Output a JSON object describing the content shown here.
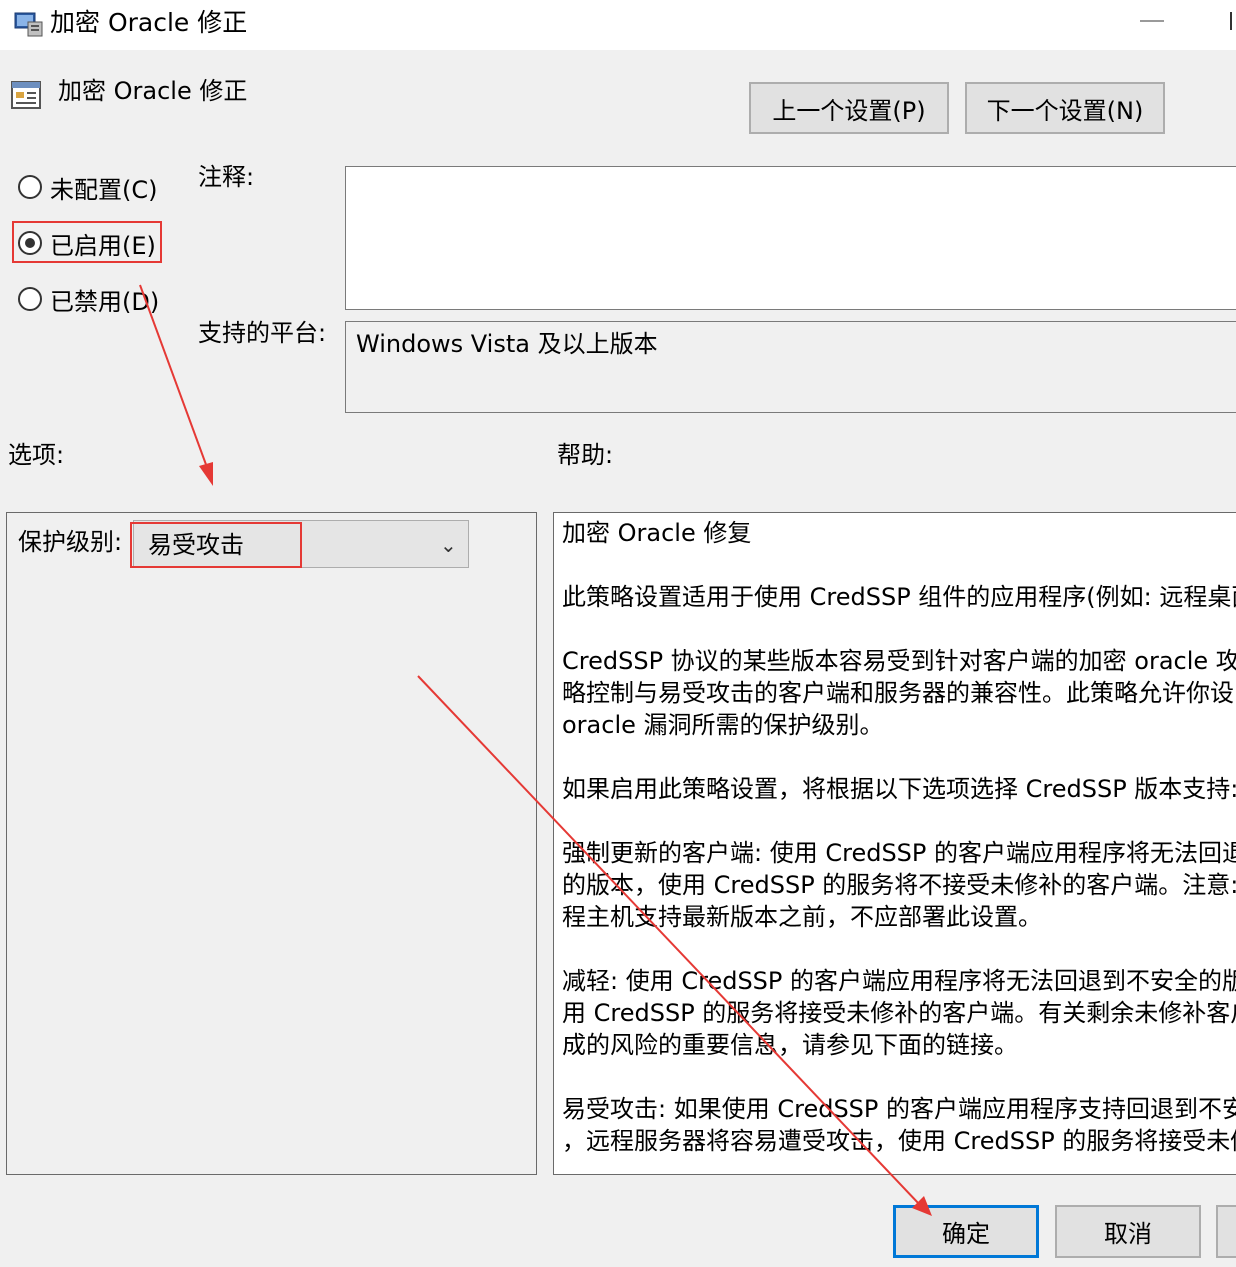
{
  "window": {
    "title": "加密 Oracle 修正"
  },
  "header": {
    "title": "加密 Oracle 修正"
  },
  "nav": {
    "prev_label": "上一个设置(P)",
    "next_label": "下一个设置(N)"
  },
  "state": {
    "not_configured_label": "未配置(C)",
    "enabled_label": "已启用(E)",
    "disabled_label": "已禁用(D)",
    "selected": "enabled"
  },
  "comment": {
    "label": "注释:",
    "value": ""
  },
  "platform": {
    "label": "支持的平台:",
    "value": "Windows Vista 及以上版本"
  },
  "options": {
    "label": "选项:",
    "protection_level_label": "保护级别:",
    "protection_level_value": "易受攻击"
  },
  "help": {
    "label": "帮助:",
    "paragraphs": [
      {
        "lines": [
          "加密 Oracle 修复"
        ]
      },
      {
        "lines": [
          "此策略设置适用于使用 CredSSP 组件的应用程序(例如: 远程桌面"
        ]
      },
      {
        "lines": [
          "CredSSP 协议的某些版本容易受到针对客户端的加密 oracle 攻击",
          "略控制与易受攻击的客户端和服务器的兼容性。此策略允许你设",
          "oracle 漏洞所需的保护级别。"
        ]
      },
      {
        "lines": [
          "如果启用此策略设置，将根据以下选项选择 CredSSP 版本支持:"
        ]
      },
      {
        "lines": [
          "强制更新的客户端: 使用 CredSSP 的客户端应用程序将无法回退到",
          "的版本，使用 CredSSP 的服务将不接受未修补的客户端。注意: 在",
          "程主机支持最新版本之前，不应部署此设置。"
        ]
      },
      {
        "lines": [
          "减轻: 使用 CredSSP 的客户端应用程序将无法回退到不安全的版本",
          "用 CredSSP 的服务将接受未修补的客户端。有关剩余未修补客户",
          "成的风险的重要信息，请参见下面的链接。"
        ]
      },
      {
        "lines": [
          "易受攻击: 如果使用 CredSSP 的客户端应用程序支持回退到不安全",
          "，远程服务器将容易遭受攻击，使用 CredSSP 的服务将接受未修"
        ]
      }
    ]
  },
  "footer": {
    "ok_label": "确定",
    "cancel_label": "取消"
  },
  "colors": {
    "annotation": "#e53935",
    "focus": "#0078d7"
  }
}
